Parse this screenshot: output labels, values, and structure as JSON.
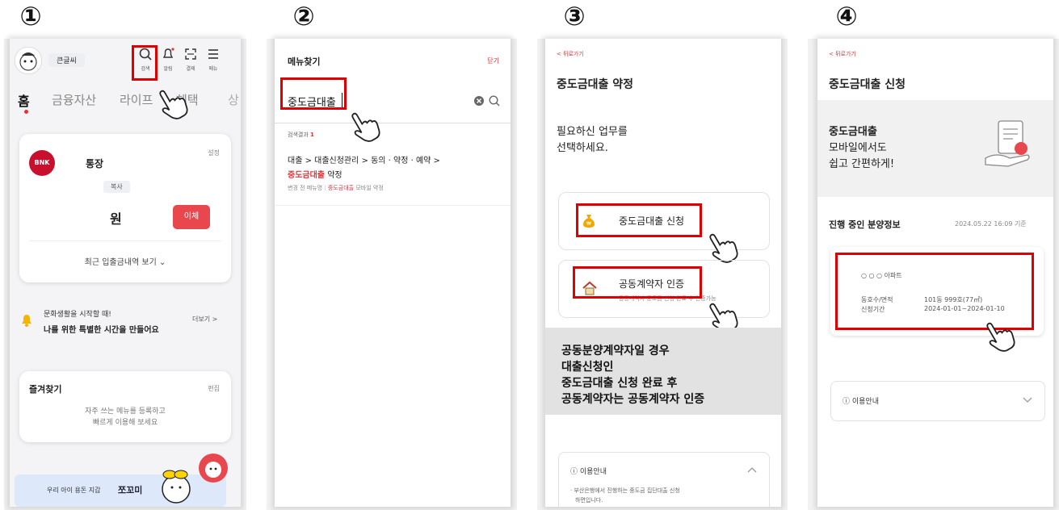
{
  "steps": [
    "①",
    "②",
    "③",
    "④"
  ],
  "panel1": {
    "user_name": "큰글씨",
    "header_icons": [
      {
        "name": "search",
        "label": "검색"
      },
      {
        "name": "bell",
        "label": "알림"
      },
      {
        "name": "scan",
        "label": "결제"
      },
      {
        "name": "menu",
        "label": "메뉴"
      }
    ],
    "tabs": [
      "홈",
      "금융자산",
      "라이프",
      "혜택",
      "상"
    ],
    "account": {
      "bank_logo": "BNK",
      "name": "통장",
      "settings": "설정",
      "copy": "복사",
      "balance_unit": "원",
      "transfer": "이체",
      "recent": "최근 입출금내역 보기 ⌄"
    },
    "promo": {
      "line1": "문화생활을 시작할 때!",
      "line2": "나를 위한 특별한 시간을 만들어요",
      "more": "더보기 >"
    },
    "favorites": {
      "title": "즐겨찾기",
      "edit": "편집",
      "line1": "자주 쓰는 메뉴를 등록하고",
      "line2": "빠르게 이용해 보세요"
    },
    "banner": {
      "text": "우리 아이 용돈 지갑",
      "brand": "쪼꼬미"
    }
  },
  "panel2": {
    "title": "메뉴찾기",
    "close": "닫기",
    "search_value": "중도금대출",
    "result_label": "검색결과",
    "result_count": "1",
    "path": "대출 > 대출신청관리 > 동의 · 약정 · 예약 >",
    "highlight": "중도금대출",
    "suffix": "약정",
    "sub_prefix": "변경 전 메뉴명",
    "sub_highlight": "중도금대출",
    "sub_suffix": "모바일 약정"
  },
  "panel3": {
    "back": "< 뒤로가기",
    "title": "중도금대출 약정",
    "prompt1": "필요하신 업무를",
    "prompt2": "선택하세요.",
    "option1": "중도금대출 신청",
    "option2": "공동계약자 인증",
    "option2_sub": "공동계약자 중도금 신청 완료 후 인증가능",
    "note": [
      "공동분양계약자일 경우",
      "대출신청인",
      "중도금대출 신청 완료 후",
      "공동계약자는 공동계약자 인증"
    ],
    "info_title": "ⓘ 이용안내",
    "info_text1": "· 부산은행에서 진행하는 중도금 집단대출 신청",
    "info_text2": "하면입니다."
  },
  "panel4": {
    "back": "< 뒤로가기",
    "title": "중도금대출 신청",
    "banner1": "중도금대출",
    "banner2": "모바일에서도",
    "banner3": "쉽고 간편하게!",
    "section": "진행 중인 분양정보",
    "timestamp": "2024.05.22 16:09 기준",
    "apt": "○ ○ ○ 아파트",
    "k1": "동호수/면적",
    "v1": "101동 999호(77㎡)",
    "k2": "신청기간",
    "v2": "2024-01-01~2024-01-10",
    "info_title": "ⓘ 이용안내"
  }
}
